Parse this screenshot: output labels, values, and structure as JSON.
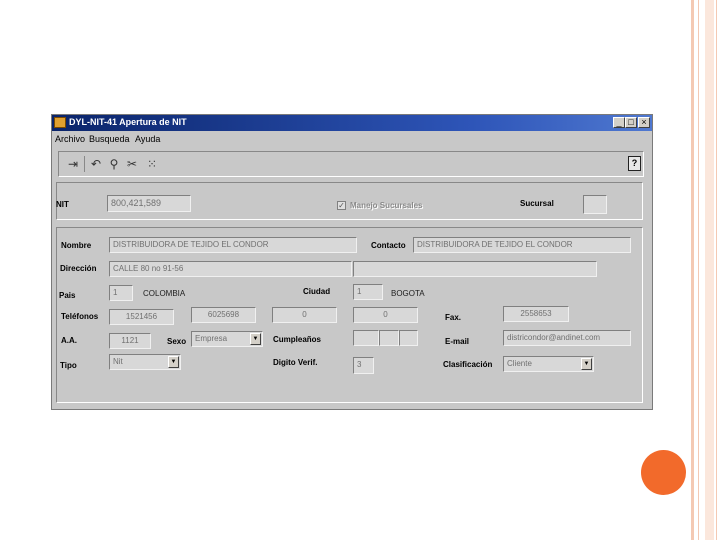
{
  "window": {
    "title": "DYL-NIT-41 Apertura de NIT",
    "minimize": "_",
    "maximize": "□",
    "close": "×"
  },
  "menu": [
    "Archivo",
    "Busqueda",
    "Ayuda"
  ],
  "toolbar": {
    "icons": [
      "exit-icon",
      "undo-icon",
      "binoculars-icon",
      "cut-icon",
      "new-record-icon"
    ],
    "help_label": "?"
  },
  "form": {
    "nit": {
      "label": "NIT",
      "value": "800,421,589"
    },
    "manejo_sucursales": {
      "label": "Manejo Sucursales",
      "checked": true
    },
    "sucursal": {
      "label": "Sucursal",
      "value": ""
    },
    "nombre": {
      "label": "Nombre",
      "value": "DISTRIBUIDORA DE TEJIDO EL CONDOR"
    },
    "contacto": {
      "label": "Contacto",
      "value": "DISTRIBUIDORA DE TEJIDO EL CONDOR"
    },
    "direccion": {
      "label": "Dirección",
      "value": "CALLE 80 no 91-56",
      "value2": ""
    },
    "pais": {
      "label": "Pais",
      "code": "1",
      "name": "COLOMBIA"
    },
    "ciudad": {
      "label": "Ciudad",
      "code": "1",
      "name": "BOGOTA"
    },
    "telefonos": {
      "label": "Teléfonos",
      "values": [
        "1521456",
        "6025698",
        "0",
        "0"
      ]
    },
    "fax": {
      "label": "Fax.",
      "value": "2558653"
    },
    "aa": {
      "label": "A.A.",
      "value": "1121"
    },
    "sexo": {
      "label": "Sexo",
      "value": "Empresa"
    },
    "cumpleanos": {
      "label": "Cumpleaños",
      "values": [
        "",
        "",
        ""
      ]
    },
    "email": {
      "label": "E-mail",
      "value": "districondor@andinet.com"
    },
    "tipo": {
      "label": "Tipo",
      "value": "Nit"
    },
    "digito": {
      "label": "Digito Verif.",
      "value": "3"
    },
    "clasificacion": {
      "label": "Clasificación",
      "value": "Cliente"
    }
  },
  "colors": {
    "accent": "#f26a2b",
    "titlebar": "#0a246a",
    "window_bg": "#c8c8c8"
  }
}
